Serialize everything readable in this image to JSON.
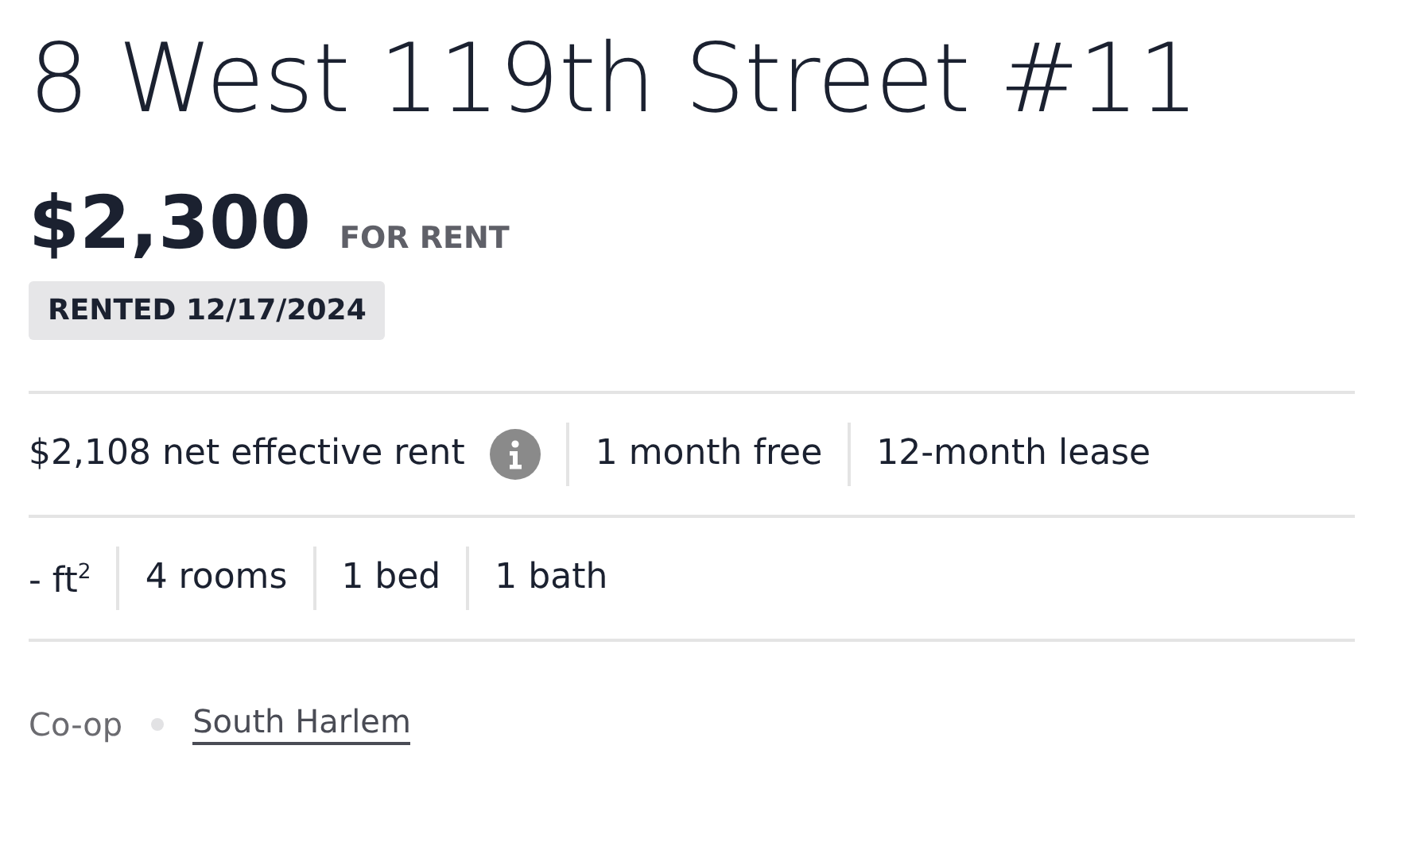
{
  "title": "8 West 119th Street #11",
  "price": {
    "amount": "$2,300",
    "label": "FOR RENT"
  },
  "status_badge": "RENTED 12/17/2024",
  "rent_details": [
    {
      "text": "$2,108 net effective rent",
      "kind": "info"
    },
    {
      "text": "1 month free",
      "kind": "plain"
    },
    {
      "text": "12-month lease",
      "kind": "plain"
    }
  ],
  "unit_details": [
    {
      "text": "- ft$^{2}$"
    },
    {
      "text": "4 rooms"
    },
    {
      "text": "1 bed"
    },
    {
      "text": "1 bath"
    }
  ],
  "footer": {
    "type": "Co-op",
    "neighborhood": "South Harlem"
  }
}
